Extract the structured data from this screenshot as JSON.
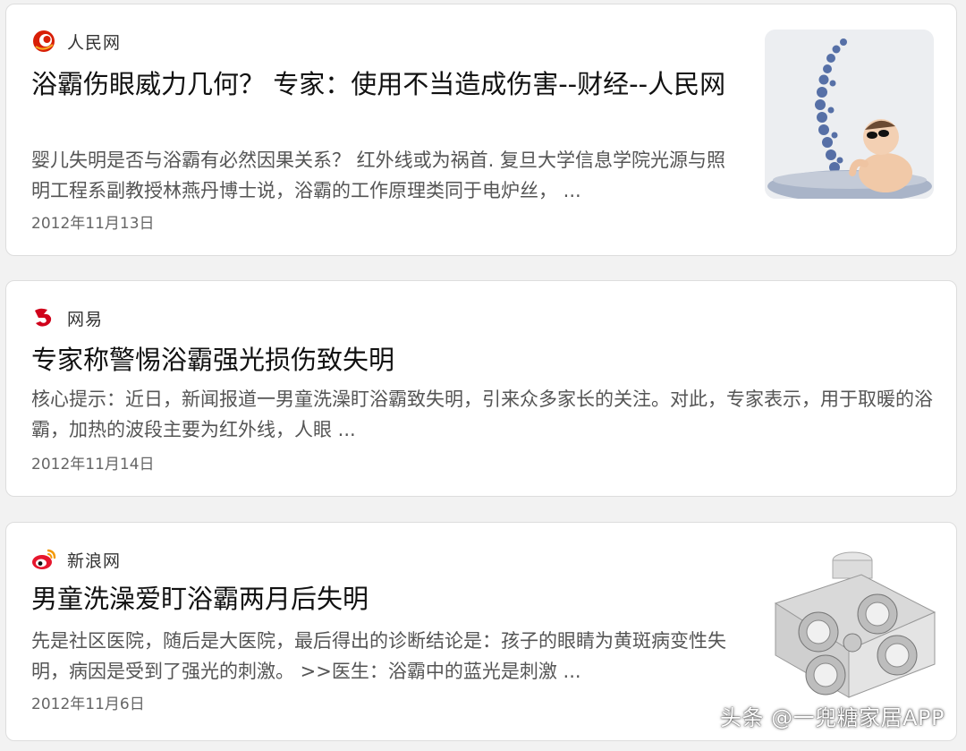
{
  "results": [
    {
      "source": "人民网",
      "source_icon": "renminwang-logo-icon",
      "title": "浴霸伤眼威力几何？ 专家：使用不当造成伤害--财经--人民网",
      "snippet": "婴儿失明是否与浴霸有必然因果关系？ 红外线或为祸首. 复旦大学信息学院光源与照明工程系副教授林燕丹博士说，浴霸的工作原理类同于电炉丝， ...",
      "date": "2012年11月13日",
      "thumbnail": "baby-in-bathtub-image"
    },
    {
      "source": "网易",
      "source_icon": "netease-logo-icon",
      "title": "专家称警惕浴霸强光损伤致失明",
      "snippet": "核心提示：近日，新闻报道一男童洗澡盯浴霸致失明，引来众多家长的关注。对此，专家表示，用于取暖的浴霸，加热的波段主要为红外线，人眼 ...",
      "date": "2012年11月14日"
    },
    {
      "source": "新浪网",
      "source_icon": "sina-weibo-logo-icon",
      "title": "男童洗澡爱盯浴霸两月后失明",
      "snippet": "先是社区医院，随后是大医院，最后得出的诊断结论是：孩子的眼睛为黄斑病变性失明，病因是受到了强光的刺激。 >>医生：浴霸中的蓝光是刺激 ...",
      "date": "2012年11月6日",
      "thumbnail": "bath-heater-lamp-image"
    }
  ],
  "watermark": "头条 @一兜糖家居APP",
  "colors": {
    "background": "#f2f2f2",
    "card": "#ffffff",
    "renmin_red": "#d81e06",
    "netease_red": "#d0021b",
    "sina_red": "#e6162d"
  }
}
